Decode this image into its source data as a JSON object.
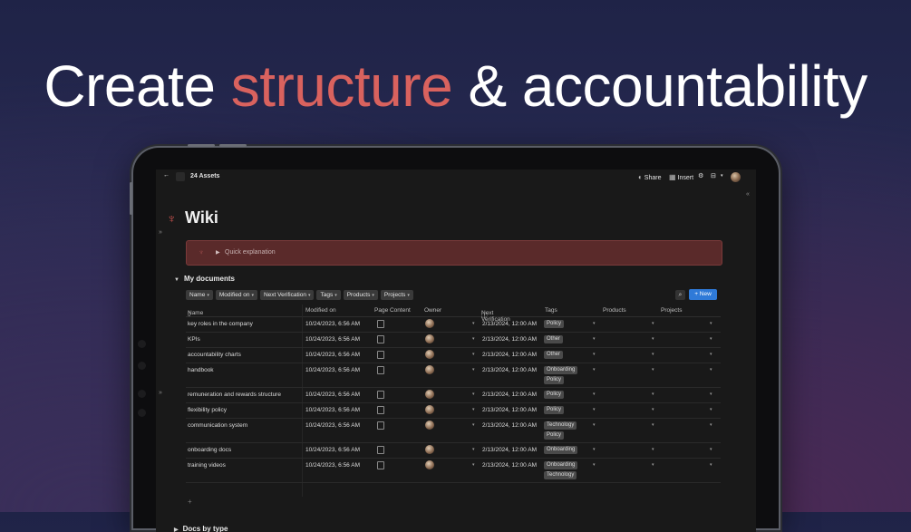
{
  "hero": {
    "prefix": "Create ",
    "accent": "structure",
    "suffix": " & accountability"
  },
  "colors": {
    "accent": "#d9625e",
    "primary_button": "#2f7ad8",
    "callout": "#5a2a2a"
  },
  "topbar": {
    "back_icon": "arrow-left-icon",
    "breadcrumb": "24 Assets",
    "share_label": "Share",
    "insert_label": "Insert"
  },
  "page": {
    "title": "Wiki",
    "icon": "rocket-icon"
  },
  "callout": {
    "label": "Quick explanation"
  },
  "sections": {
    "my_documents": "My documents",
    "docs_by_type": "Docs by type"
  },
  "filters": [
    "Name",
    "Modified on",
    "Next Verification",
    "Tags",
    "Products",
    "Projects"
  ],
  "new_button": "New",
  "columns": [
    "Name",
    "Modified on",
    "Page Content",
    "Owner",
    "Next Verification",
    "Tags",
    "Products",
    "Projects"
  ],
  "rows": [
    {
      "name": "key roles in the company",
      "modified": "10/24/2023, 6:56 AM",
      "next": "2/13/2024, 12:00 AM",
      "tags": [
        "Policy"
      ]
    },
    {
      "name": "KPIs",
      "modified": "10/24/2023, 6:56 AM",
      "next": "2/13/2024, 12:00 AM",
      "tags": [
        "Other"
      ]
    },
    {
      "name": "accountability charts",
      "modified": "10/24/2023, 6:56 AM",
      "next": "2/13/2024, 12:00 AM",
      "tags": [
        "Other"
      ]
    },
    {
      "name": "handbook",
      "modified": "10/24/2023, 6:56 AM",
      "next": "2/13/2024, 12:00 AM",
      "tags": [
        "Onboarding",
        "Policy"
      ]
    },
    {
      "name": "remuneration and rewards structure",
      "modified": "10/24/2023, 6:56 AM",
      "next": "2/13/2024, 12:00 AM",
      "tags": [
        "Policy"
      ]
    },
    {
      "name": "flexibility policy",
      "modified": "10/24/2023, 6:56 AM",
      "next": "2/13/2024, 12:00 AM",
      "tags": [
        "Policy"
      ]
    },
    {
      "name": "communication system",
      "modified": "10/24/2023, 6:56 AM",
      "next": "2/13/2024, 12:00 AM",
      "tags": [
        "Technology",
        "Policy"
      ]
    },
    {
      "name": "onboarding docs",
      "modified": "10/24/2023, 6:56 AM",
      "next": "2/13/2024, 12:00 AM",
      "tags": [
        "Onboarding"
      ]
    },
    {
      "name": "training videos",
      "modified": "10/24/2023, 6:56 AM",
      "next": "2/13/2024, 12:00 AM",
      "tags": [
        "Onboarding",
        "Technology"
      ]
    }
  ]
}
